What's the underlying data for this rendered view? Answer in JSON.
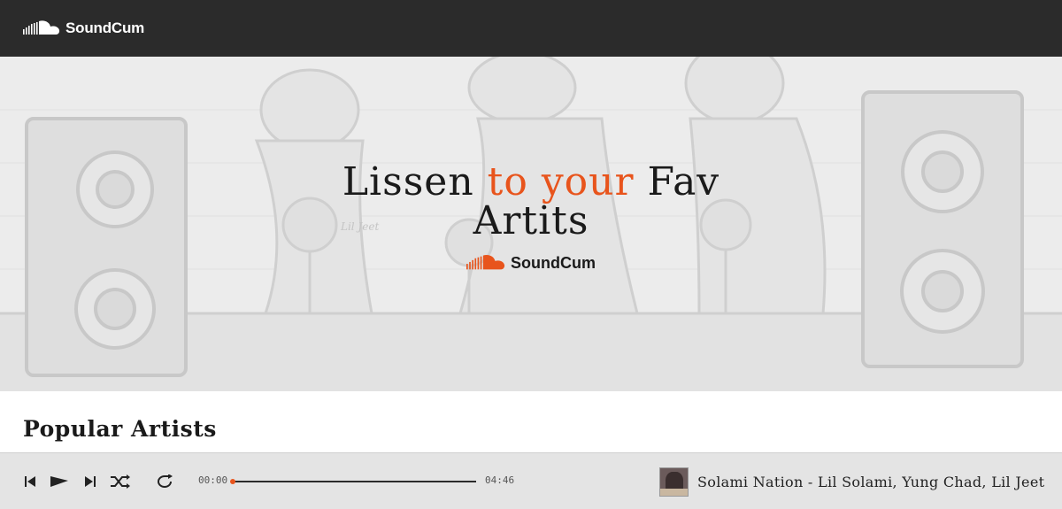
{
  "header": {
    "brand": "SoundCum",
    "logo_icon": "soundcloud-cloud-icon"
  },
  "hero": {
    "headline_part1": "Lissen ",
    "headline_accent": "to your",
    "headline_part2": " Fav",
    "headline_line2": "Artits",
    "brand": "SoundCum",
    "art_text": "Lil Jeet",
    "colors": {
      "accent": "#e8541c",
      "logo_orange": "#e8541c"
    }
  },
  "section": {
    "title": "Popular Artists"
  },
  "player": {
    "icons": [
      "previous-icon",
      "play-icon",
      "next-icon",
      "shuffle-icon",
      "repeat-icon"
    ],
    "current_time": "00:00",
    "total_time": "04:46",
    "progress": 0,
    "now_playing": "Solami Nation - Lil Solami, Yung Chad, Lil Jeet"
  }
}
